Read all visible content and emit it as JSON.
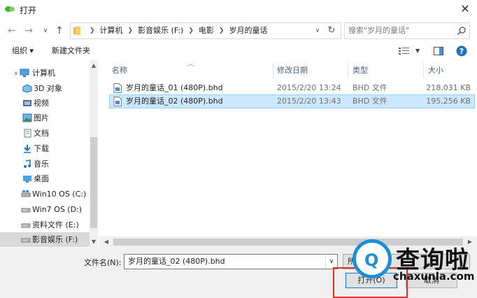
{
  "window": {
    "title": "打开"
  },
  "address": {
    "crumbs": [
      "计算机",
      "影音娱乐 (F:)",
      "电影",
      "岁月的童话"
    ]
  },
  "search": {
    "placeholder": "搜索\"岁月的童话\""
  },
  "toolbar": {
    "organize": "组织 ▾",
    "new_folder": "新建文件夹"
  },
  "sidebar": {
    "items": [
      {
        "label": "计算机",
        "icon": "computer-icon"
      },
      {
        "label": "3D 对象",
        "icon": "3d-objects-icon"
      },
      {
        "label": "视频",
        "icon": "video-icon"
      },
      {
        "label": "图片",
        "icon": "pictures-icon"
      },
      {
        "label": "文档",
        "icon": "documents-icon"
      },
      {
        "label": "下载",
        "icon": "download-icon"
      },
      {
        "label": "音乐",
        "icon": "music-icon"
      },
      {
        "label": "桌面",
        "icon": "desktop-icon"
      },
      {
        "label": "Win10 OS (C:)",
        "icon": "drive-icon"
      },
      {
        "label": "Win7 OS (D:)",
        "icon": "drive-icon"
      },
      {
        "label": "资料文件 (E:)",
        "icon": "drive-icon"
      },
      {
        "label": "影音娱乐 (F:)",
        "icon": "drive-icon"
      }
    ]
  },
  "columns": {
    "name": "名称",
    "modified": "修改日期",
    "type": "类型",
    "size": "大小"
  },
  "files": [
    {
      "name": "岁月的童话_01 (480P).bhd",
      "modified": "2015/2/20 13:24",
      "type": "BHD 文件",
      "size": "218,031 KB"
    },
    {
      "name": "岁月的童话_02 (480P).bhd",
      "modified": "2015/2/20 13:43",
      "type": "BHD 文件",
      "size": "195,256 KB"
    }
  ],
  "bottom": {
    "filename_label": "文件名(N):",
    "filename_value": "岁月的童话_02 (480P).bhd",
    "filter_partial": "所",
    "open_label": "打开(O)",
    "cancel_label": "取消"
  },
  "watermark": {
    "char": "Q",
    "text": "查询啦",
    "domain": "chaxunla.com"
  },
  "colors": {
    "accent": "#0078d7",
    "selection": "#cce8ff",
    "highlight": "#e0302a",
    "watermark_blue": "#1b8fd8"
  }
}
